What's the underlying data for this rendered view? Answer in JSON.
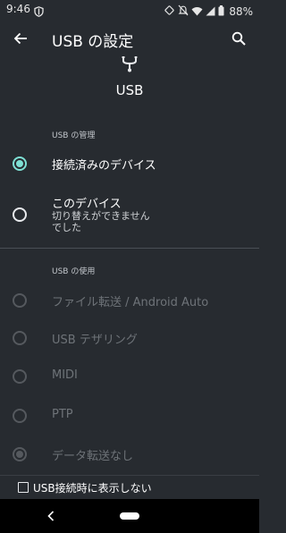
{
  "status_bar": {
    "time": "9:46",
    "battery": "88%"
  },
  "app_bar": {
    "title": "USB の設定"
  },
  "header": {
    "title": "USB"
  },
  "sections": {
    "management": {
      "label": "USB の管理",
      "options": [
        {
          "label": "接続済みのデバイス",
          "checked": true
        },
        {
          "label": "このデバイス",
          "subtitle": "切り替えができませんでした",
          "checked": false
        }
      ]
    },
    "usage": {
      "label": "USB の使用",
      "options": [
        {
          "label": "ファイル転送 / Android Auto",
          "checked": false,
          "enabled": false
        },
        {
          "label": "USB テザリング",
          "checked": false,
          "enabled": false
        },
        {
          "label": "MIDI",
          "checked": false,
          "enabled": false
        },
        {
          "label": "PTP",
          "checked": false,
          "enabled": false
        },
        {
          "label": "データ転送なし",
          "checked": true,
          "enabled": false
        }
      ]
    }
  },
  "footer": {
    "checkbox_label": "USB接続時に表示しない",
    "checked": false
  },
  "icons": {
    "back": "back-arrow-icon",
    "search": "search-icon",
    "usb": "usb-icon",
    "nav_back": "nav-back-icon",
    "nav_home": "nav-home-pill"
  },
  "colors": {
    "background": "#272b30",
    "accent": "#7ee0d4",
    "disabled": "#6e7378"
  }
}
